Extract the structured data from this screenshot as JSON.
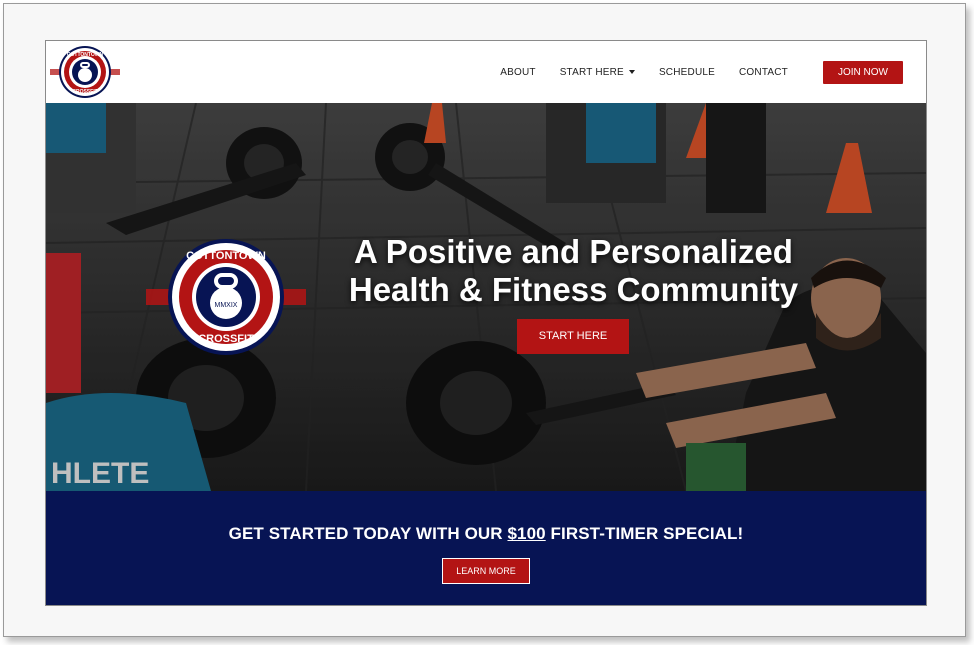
{
  "brand": {
    "name_top": "COTTONTOWN",
    "name_bottom": "CROSSFIT",
    "est": "MMXIX",
    "colors": {
      "red": "#b31414",
      "navy": "#071454"
    }
  },
  "nav": {
    "items": [
      "ABOUT",
      "START HERE",
      "SCHEDULE",
      "CONTACT"
    ],
    "join_label": "JOIN NOW"
  },
  "hero": {
    "title_line1": "A Positive and Personalized",
    "title_line2": "Health & Fitness Community",
    "cta_label": "START HERE",
    "shirt_text": "HLETE"
  },
  "promo": {
    "text_before": "GET STARTED TODAY WITH OUR ",
    "text_highlight": "$100",
    "text_after": " FIRST-TIMER SPECIAL!",
    "button_label": "LEARN MORE"
  }
}
